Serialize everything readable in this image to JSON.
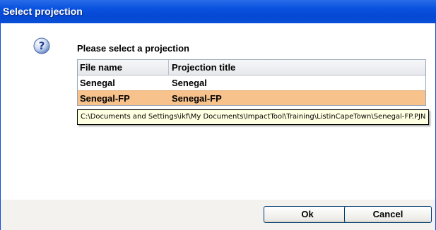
{
  "window": {
    "title": "Select projection"
  },
  "dialog": {
    "prompt": "Please select a projection",
    "help_icon": "question-mark-icon"
  },
  "grid": {
    "columns": [
      "File name",
      "Projection title"
    ],
    "rows": [
      {
        "file_name": "Senegal",
        "projection_title": "Senegal",
        "selected": false
      },
      {
        "file_name": "Senegal-FP",
        "projection_title": "Senegal-FP",
        "selected": true
      }
    ],
    "selected_row_color": "#f7c28b"
  },
  "tooltip": {
    "text": "C:\\Documents and Settings\\ikf\\My Documents\\ImpactTool\\Training\\ListinCapeTown\\Senegal-FP.PJN"
  },
  "buttons": {
    "ok_label": "Ok",
    "cancel_label": "Cancel"
  },
  "colors": {
    "titlebar": "#0a53e0",
    "footer": "#f3f2ee"
  }
}
